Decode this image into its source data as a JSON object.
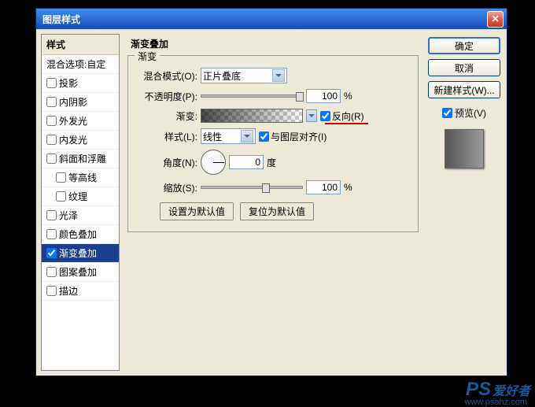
{
  "dialog": {
    "title": "图层样式"
  },
  "sidebar": {
    "header": "样式",
    "blend_options": "混合选项:自定",
    "items": [
      {
        "label": "投影",
        "checked": false
      },
      {
        "label": "内阴影",
        "checked": false
      },
      {
        "label": "外发光",
        "checked": false
      },
      {
        "label": "内发光",
        "checked": false
      },
      {
        "label": "斜面和浮雕",
        "checked": false
      },
      {
        "label": "等高线",
        "checked": false,
        "sub": true
      },
      {
        "label": "纹理",
        "checked": false,
        "sub": true
      },
      {
        "label": "光泽",
        "checked": false
      },
      {
        "label": "颜色叠加",
        "checked": false
      },
      {
        "label": "渐变叠加",
        "checked": true,
        "selected": true
      },
      {
        "label": "图案叠加",
        "checked": false
      },
      {
        "label": "描边",
        "checked": false
      }
    ]
  },
  "panel": {
    "title": "渐变叠加",
    "group": "渐变",
    "blend_mode_label": "混合模式(O):",
    "blend_mode_value": "正片叠底",
    "opacity_label": "不透明度(P):",
    "opacity_value": "100",
    "percent": "%",
    "gradient_label": "渐变:",
    "reverse_label": "反向(R)",
    "style_label": "样式(L):",
    "style_value": "线性",
    "align_label": "与图层对齐(I)",
    "angle_label": "角度(N):",
    "angle_value": "0",
    "degree": "度",
    "scale_label": "缩放(S):",
    "scale_value": "100",
    "default_btn": "设置为默认值",
    "reset_btn": "复位为默认值"
  },
  "buttons": {
    "ok": "确定",
    "cancel": "取消",
    "new_style": "新建样式(W)...",
    "preview": "预览(V)"
  },
  "watermark": {
    "main": "PS",
    "sub": "爱好者",
    "url": "www.psahz.com"
  }
}
